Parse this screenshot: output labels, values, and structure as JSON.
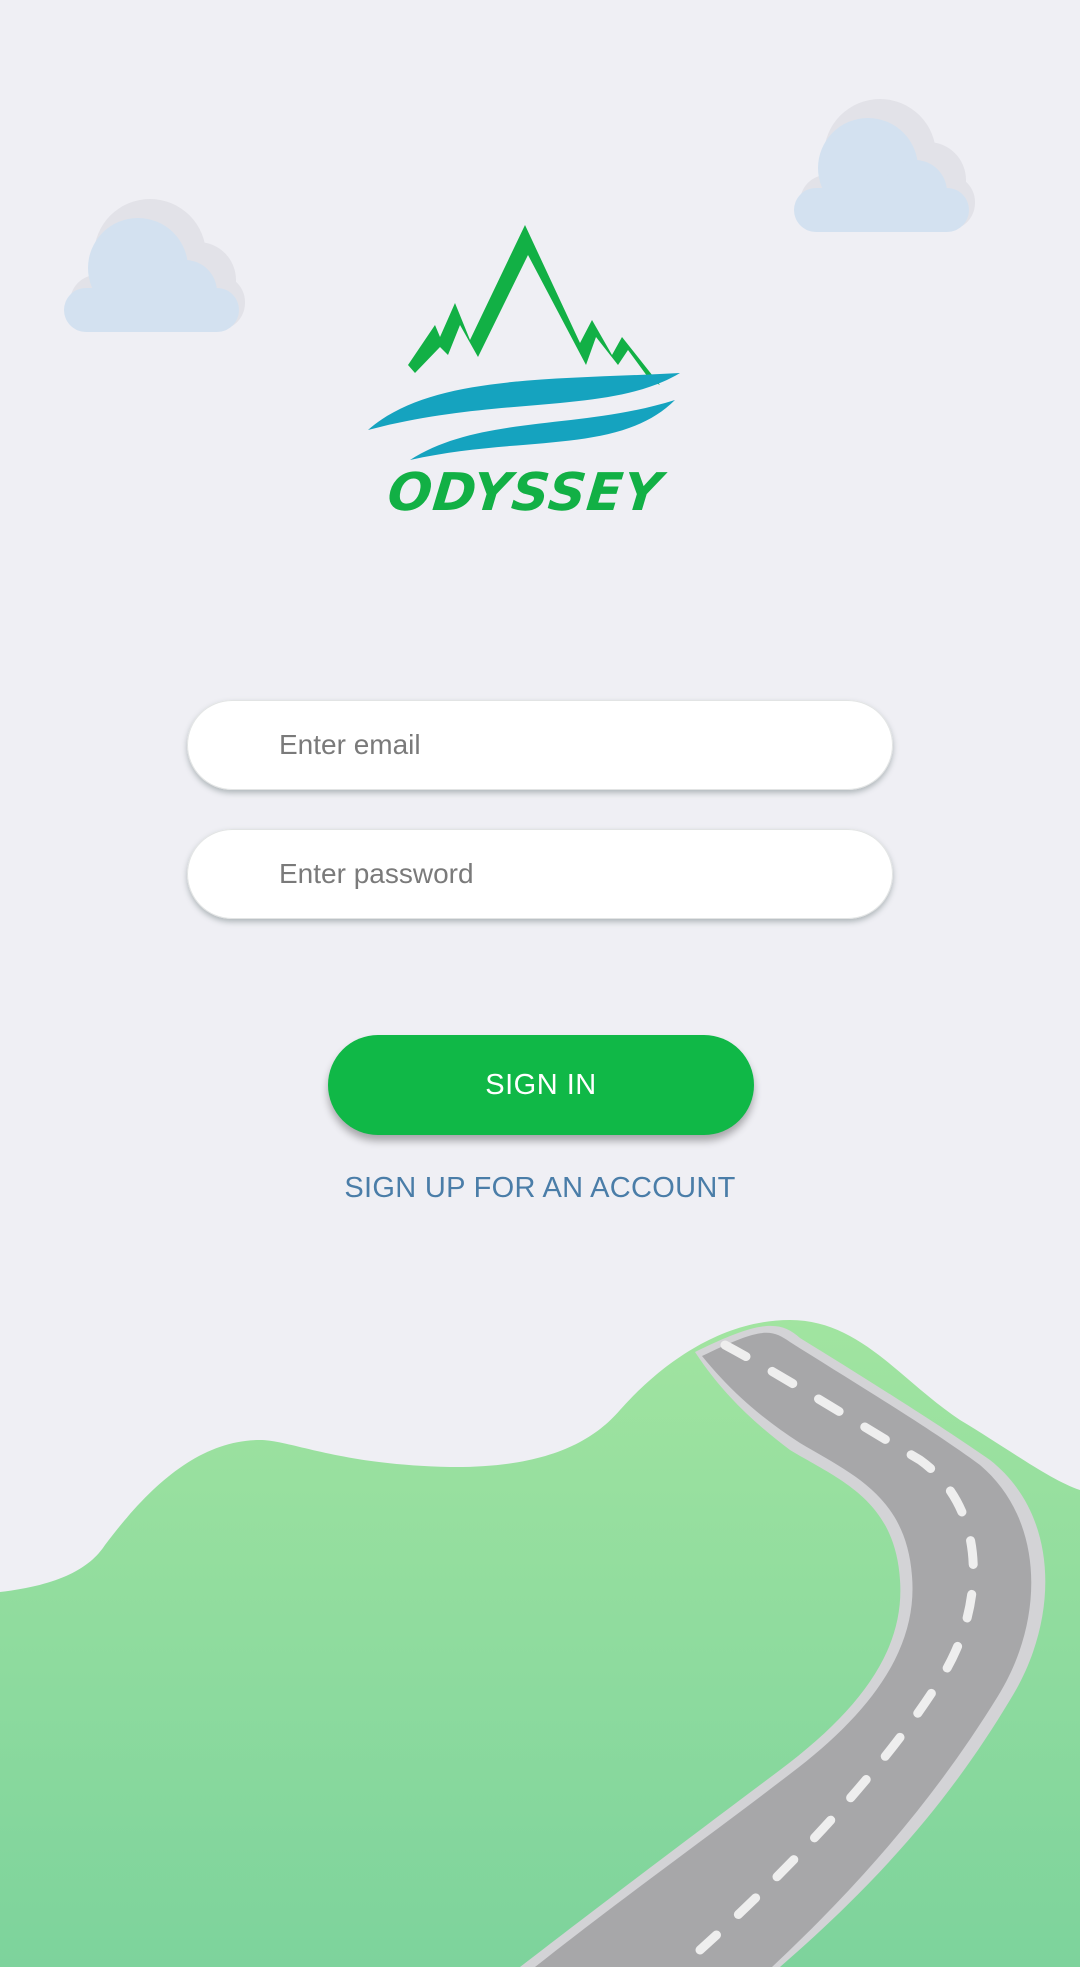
{
  "brand": {
    "name": "ODYSSEY",
    "color": "#12b045",
    "wave_color": "#15a3bf"
  },
  "login_form": {
    "email_placeholder": "Enter email",
    "password_placeholder": "Enter password",
    "sign_in_label": "SIGN IN",
    "sign_up_label": "SIGN UP FOR AN ACCOUNT"
  },
  "colors": {
    "background": "#efeff4",
    "primary_button": "#10b847",
    "link": "#4a7da8",
    "hill": "#8edc9b",
    "road": "#a7a7a9"
  },
  "icons": [
    "cloud-icon",
    "mountain-logo-icon",
    "road-illustration"
  ]
}
